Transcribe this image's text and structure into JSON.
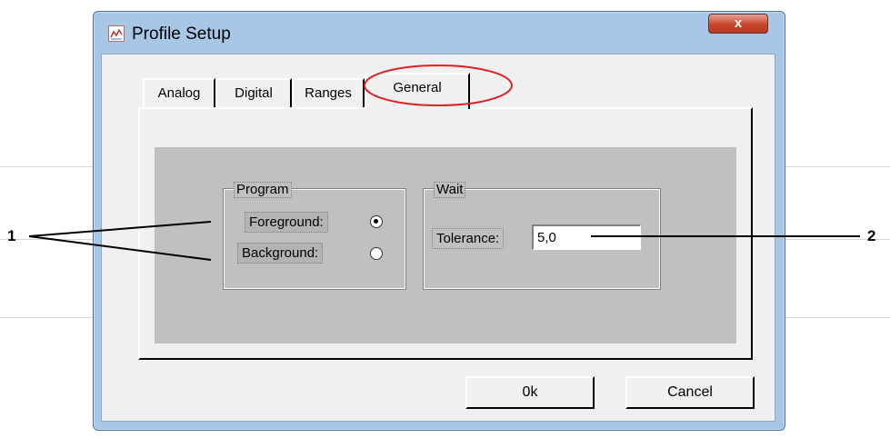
{
  "window": {
    "title": "Profile Setup",
    "close_label": "x"
  },
  "tabs": [
    {
      "label": "Analog"
    },
    {
      "label": "Digital"
    },
    {
      "label": "Ranges"
    },
    {
      "label": "General",
      "active": true
    }
  ],
  "program_group": {
    "title": "Program",
    "options": [
      {
        "label": "Foreground:",
        "selected": true
      },
      {
        "label": "Background:",
        "selected": false
      }
    ]
  },
  "wait_group": {
    "title": "Wait",
    "tolerance_label": "Tolerance:",
    "tolerance_value": "5,0"
  },
  "buttons": {
    "ok": "0k",
    "cancel": "Cancel"
  },
  "annotations": {
    "callout_1": "1",
    "callout_2": "2"
  },
  "colors": {
    "highlight_circle": "#e02020",
    "close_button": "#c9462c"
  }
}
